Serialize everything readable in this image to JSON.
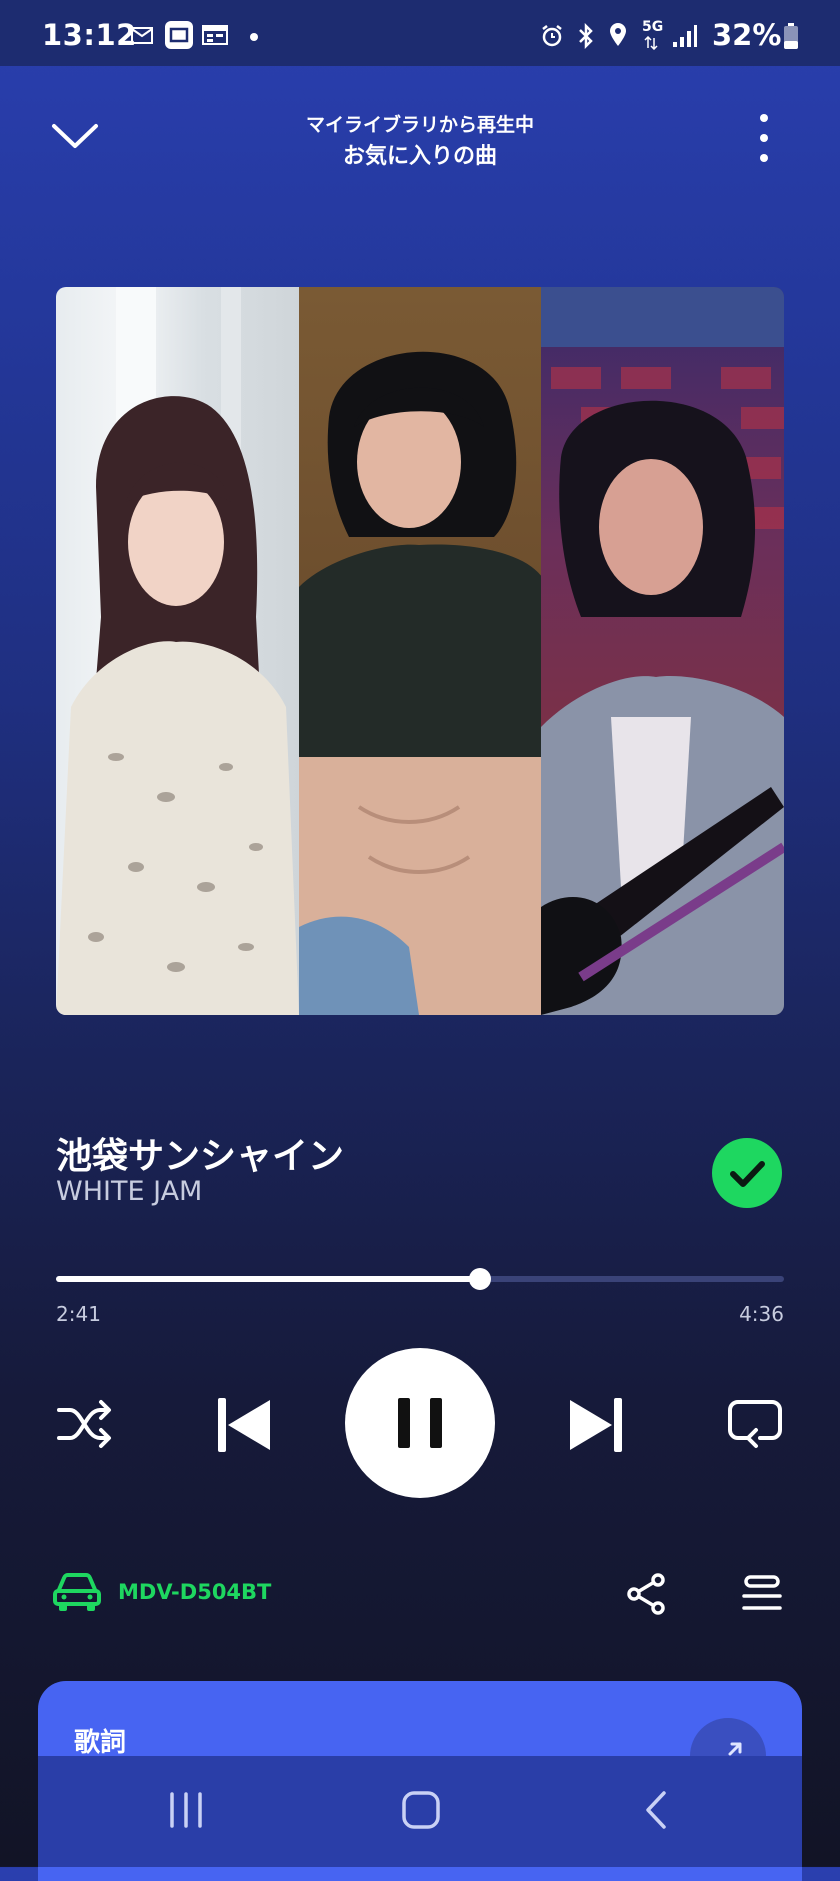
{
  "status_bar": {
    "time": "13:12",
    "network": "5G",
    "battery": "32%",
    "left_icons": [
      "mail-icon",
      "news-app-icon",
      "calendar-icon",
      "dot-icon"
    ],
    "right_icons": [
      "alarm-icon",
      "bluetooth-icon",
      "location-icon",
      "signal-icon",
      "battery-icon"
    ]
  },
  "header": {
    "subtitle": "マイライブラリから再生中",
    "title": "お気に入りの曲"
  },
  "track": {
    "title": "池袋サンシャイン",
    "artist": "WHITE JAM",
    "liked": true
  },
  "progress": {
    "elapsed": "2:41",
    "total": "4:36",
    "fraction": 0.583
  },
  "controls": [
    "shuffle-icon",
    "previous-icon",
    "pause-icon",
    "next-icon",
    "repeat-icon"
  ],
  "device": {
    "name": "MDV-D504BT"
  },
  "lyrics": {
    "label": "歌詞"
  },
  "colors": {
    "accent_green": "#1ed760",
    "lyrics_card": "#4764f2",
    "background_top": "#2a3faf",
    "background_bottom": "#121426"
  }
}
